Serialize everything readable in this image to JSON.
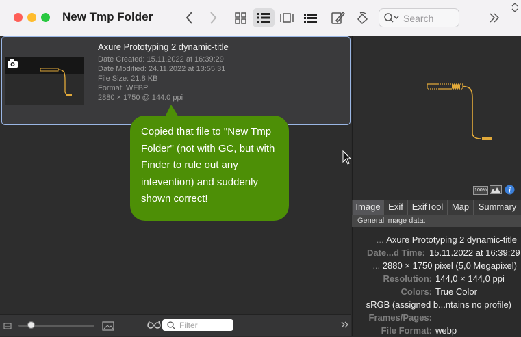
{
  "window": {
    "title": "New Tmp Folder"
  },
  "toolbar": {
    "search_placeholder": "Search"
  },
  "file": {
    "name": "Axure Prototyping 2 dynamic-title",
    "date_created": "Date Created: 15.11.2022 at 16:39:29",
    "date_modified": "Date Modified: 24.11.2022 at 13:55:31",
    "file_size": "File Size: 21.8 KB",
    "format": "Format: WEBP",
    "dimensions": "2880 × 1750 @ 144.0 ppi"
  },
  "callout": {
    "text": "Copied that file to \"New Tmp Folder\" (not with GC, but with Finder to rule out any intevention)  and suddenly shown correct!"
  },
  "bottom_bar": {
    "filter_placeholder": "Filter"
  },
  "preview": {
    "zoom_badge": "100%"
  },
  "inspector": {
    "tabs": [
      "Image",
      "Exif",
      "ExifTool",
      "Map",
      "Summary"
    ],
    "section_title": "General image data:",
    "rows": [
      {
        "label": "...",
        "value": "Axure Prototyping 2 dynamic-title"
      },
      {
        "label": "Date...d Time:",
        "value": "15.11.2022 at 16:39:29"
      },
      {
        "label": "...",
        "value": "2880 × 1750 pixel (5,0 Megapixel)"
      },
      {
        "label": "Resolution:",
        "value": "144,0 × 144,0 ppi"
      },
      {
        "label": "Colors:",
        "value": "True Color"
      },
      {
        "label": "",
        "value": "sRGB (assigned b...ntains no profile)"
      },
      {
        "label": "Frames/Pages:",
        "value": ""
      },
      {
        "label": "File Format:",
        "value": "webp"
      }
    ]
  },
  "colors": {
    "selection_border": "#9ab6e4",
    "callout": "#4d8f06",
    "thumbnail_line": "#e1a93a",
    "info_badge": "#3b7fd9"
  }
}
